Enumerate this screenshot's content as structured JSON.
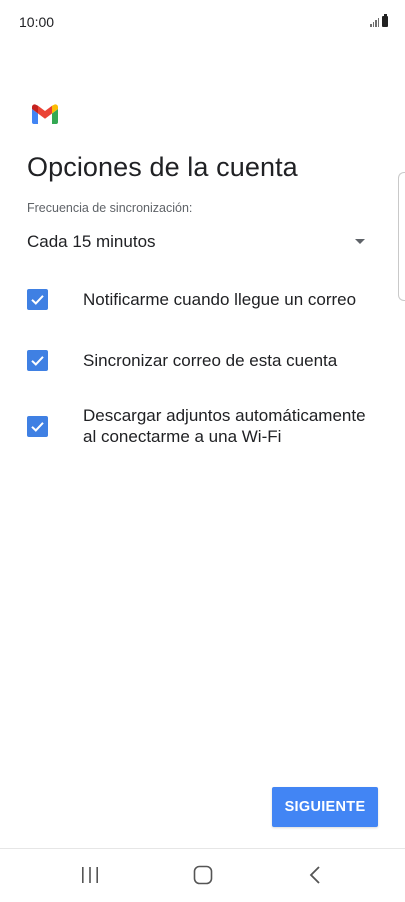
{
  "status_bar": {
    "time": "10:00",
    "signal_icon": "signal-bars-icon",
    "battery_icon": "battery-icon"
  },
  "app": {
    "logo_icon": "gmail-logo-icon"
  },
  "screen": {
    "title": "Opciones de la cuenta",
    "sync_label": "Frecuencia de sincronización:",
    "sync_value": "Cada 15 minutos"
  },
  "options": [
    {
      "label": "Notificarme cuando llegue un correo",
      "checked": true
    },
    {
      "label": "Sincronizar correo de esta cuenta",
      "checked": true
    },
    {
      "label": "Descargar adjuntos automáticamente al conectarme a una Wi-Fi",
      "checked": true
    }
  ],
  "actions": {
    "next_label": "SIGUIENTE"
  },
  "colors": {
    "accent": "#4285f4",
    "checkbox": "#3f80e3"
  },
  "nav_bar": {
    "recents_icon": "recents-icon",
    "home_icon": "home-icon",
    "back_icon": "back-icon"
  }
}
